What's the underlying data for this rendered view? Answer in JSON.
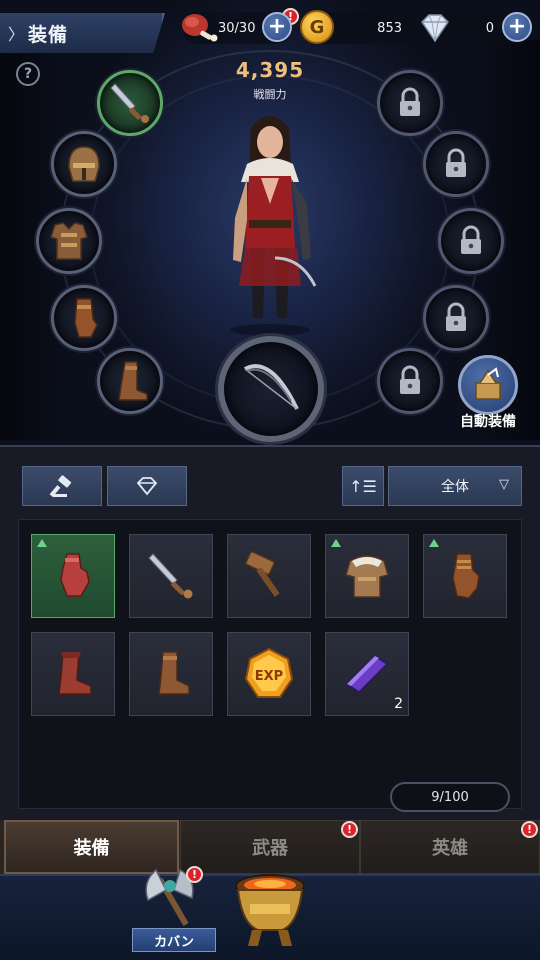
{
  "header": {
    "title": "装備",
    "back_symbol": "〉"
  },
  "resources": {
    "stamina": {
      "icon": "meat-icon",
      "value": "30/30",
      "badge": "!"
    },
    "gold": {
      "icon": "gold-coin-icon",
      "symbol": "G",
      "value": "853"
    },
    "gems": {
      "icon": "diamond-icon",
      "value": "0"
    },
    "plus_symbol": "+"
  },
  "help_symbol": "?",
  "power": {
    "value": "4,395",
    "label": "戦闘力"
  },
  "auto_equip": {
    "label": "自動装備"
  },
  "filters": {
    "equipment_icon": "hammer-icon",
    "gem_icon": "diamond-icon",
    "sort_symbol": "↑☰",
    "category_selected": "全体",
    "caret": "▽"
  },
  "items": [
    {
      "name": "leather-glove",
      "upgrade": true,
      "selected": true,
      "qty": ""
    },
    {
      "name": "crystal-dagger",
      "upgrade": false,
      "selected": false,
      "qty": ""
    },
    {
      "name": "wooden-hammer",
      "upgrade": false,
      "selected": false,
      "qty": ""
    },
    {
      "name": "fur-chest-armor",
      "upgrade": true,
      "selected": false,
      "qty": ""
    },
    {
      "name": "bracer-glove",
      "upgrade": true,
      "selected": false,
      "qty": ""
    },
    {
      "name": "red-boots",
      "upgrade": false,
      "selected": false,
      "qty": ""
    },
    {
      "name": "brown-boots",
      "upgrade": false,
      "selected": false,
      "qty": ""
    },
    {
      "name": "exp-stone",
      "upgrade": false,
      "selected": false,
      "qty": ""
    },
    {
      "name": "purple-ingot",
      "upgrade": false,
      "selected": false,
      "qty": "2"
    }
  ],
  "capacity": "9/100",
  "tabs": [
    {
      "label": "装備",
      "active": true,
      "badge": ""
    },
    {
      "label": "武器",
      "active": false,
      "badge": "!"
    },
    {
      "label": "英雄",
      "active": false,
      "badge": "!"
    }
  ],
  "nav": {
    "bag": {
      "label": "カバン",
      "badge": "!"
    }
  },
  "colors": {
    "accent_power": "#f0bf7c",
    "selected_green": "#2e5f3d",
    "badge_red": "#d8242a"
  }
}
